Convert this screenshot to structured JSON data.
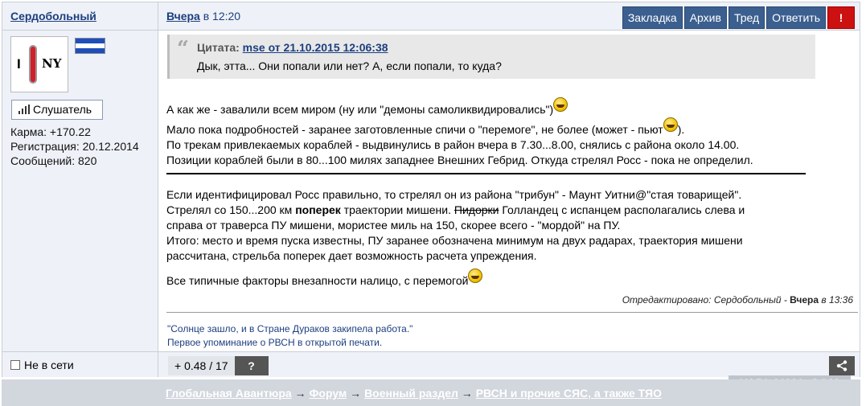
{
  "post": {
    "author": "Сердобольный",
    "date_day": "Вчера",
    "date_time": " в 12:20"
  },
  "actions": [
    {
      "label": "Закладка"
    },
    {
      "label": "Архив"
    },
    {
      "label": "Тред"
    },
    {
      "label": "Ответить"
    },
    {
      "label": "!"
    }
  ],
  "profile": {
    "avatar_text_left": "I",
    "avatar_text_right": "NY",
    "rank": "Слушатель",
    "karma": "Карма: +170.22",
    "registered": "Регистрация: 20.12.2014",
    "posts": "Сообщений: 820"
  },
  "quote": {
    "label": "Цитата: ",
    "source": "mse от 21.10.2015 12:06:38",
    "text": "Дык, этта... Они попали или нет? А, если попали, то куда?"
  },
  "body": {
    "p1": "А как же  - завалили всем миром (ну или \"демоны самоликвидировались\")",
    "p2a": "Мало пока подробностей - заранее заготовленные спичи о \"перемоге\", не более (может - пьют",
    "p2b": ").",
    "p3": "По трекам привлекаемых кораблей - выдвинулись в район вчера в 7.30...8.00, снялись с района около 14.00.",
    "p4": "Позиции кораблей были в 80...100 милях западнее Внешних Гебрид. Откуда стрелял Росс - пока не определил.",
    "p5": "Если идентифицировал Росс правильно, то стрелял он из района \"трибун\" - Маунт Уитни@\"стая товарищей\".",
    "p6a": "Стрелял со 150...200 км ",
    "p6bold": "поперек",
    "p6b": "  траектории мишени. ",
    "p6strike": "Пидорки",
    "p6c": " Голландец с испанцем располагались слева и",
    "p7": "справа от траверса ПУ мишени, мористее миль на 150, скорее всего - \"мордой\" на ПУ.",
    "p8": "Итого: место и время пуска известны, ПУ заранее обозначена минимум на двух радарах, траектория мишени",
    "p9": "рассчитана, стрельба поперек дает возможность расчета упреждения.",
    "p10": "Все типичные факторы внезапности налицо, с перемогой"
  },
  "edited": {
    "prefix": "Отредактировано: Сердобольный - ",
    "day": "Вчера",
    "time": " в 13:36"
  },
  "signature": {
    "line1": "\"Солнце зашло, и в Стране Дураков закипела работа.\"",
    "line2": "Первое упоминание о РВСН в открытой печати."
  },
  "status": {
    "online": "Не в сети",
    "score": "+ 0.48 / 17",
    "help": "?"
  },
  "breadcrumbs": {
    "c1": "Глобальная Авантюра",
    "c2": "Форум",
    "c3": "Военный раздел",
    "c4": "РВСН и прочие СЯС, а также ТЯО",
    "sep": " → "
  },
  "watermark": "YAPLAKAL.COM"
}
